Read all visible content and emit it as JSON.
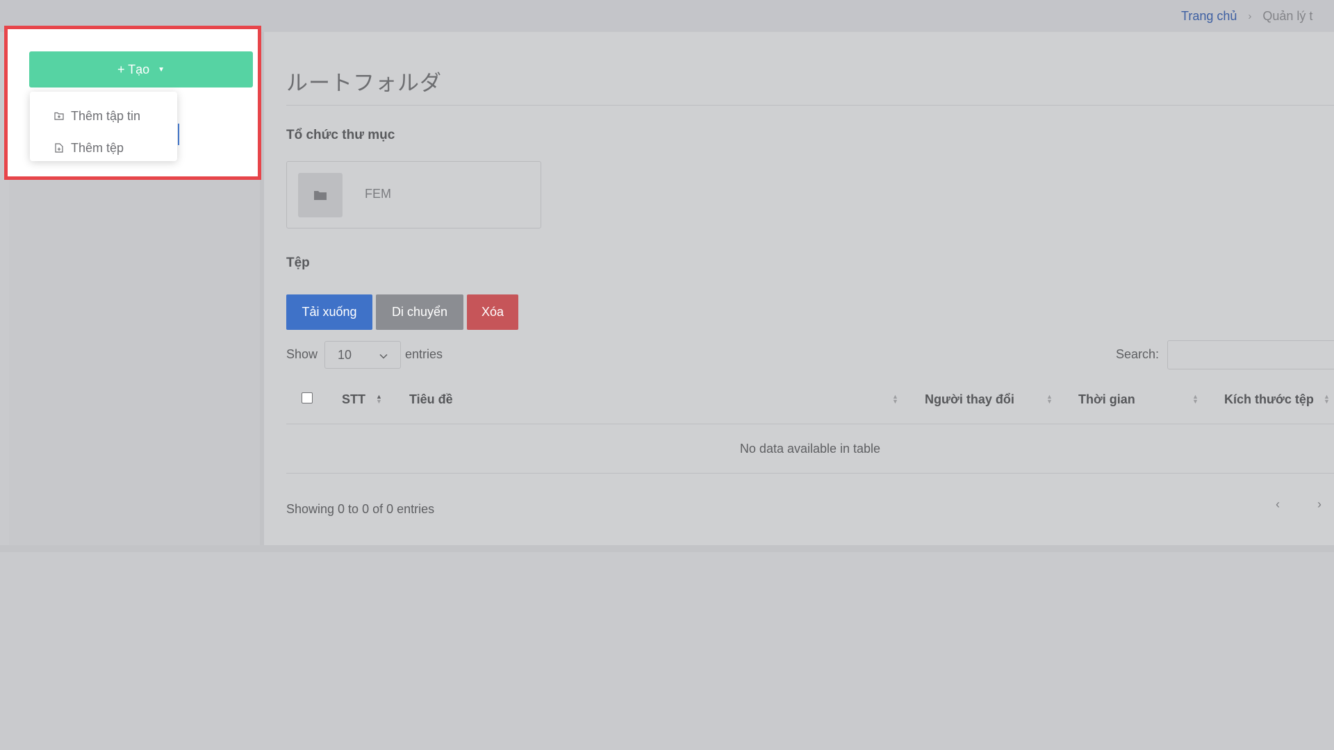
{
  "breadcrumb": {
    "home": "Trang chủ",
    "separator": "›",
    "current": "Quản lý t"
  },
  "create_menu": {
    "button_label": "+ Tạo",
    "items": [
      {
        "label": "Thêm tập tin",
        "icon": "folder-plus-icon"
      },
      {
        "label": "Thêm tệp",
        "icon": "file-plus-icon"
      }
    ]
  },
  "main": {
    "page_title": "ルートフォルダ",
    "folders_heading": "Tổ chức thư mục",
    "folders": [
      {
        "name": "FEM",
        "icon": "folder-icon"
      }
    ],
    "files_heading": "Tệp",
    "actions": {
      "download": "Tải xuống",
      "move": "Di chuyển",
      "delete": "Xóa"
    },
    "table_controls": {
      "show": "Show",
      "page_size": "10",
      "entries": "entries",
      "search_label": "Search:",
      "search_value": ""
    },
    "columns": [
      "STT",
      "Tiêu đề",
      "Người thay đổi",
      "Thời gian",
      "Kích thước tệp"
    ],
    "empty_message": "No data available in table",
    "info": "Showing 0 to 0 of 0 entries",
    "pagination": {
      "prev": "‹",
      "next": "›"
    }
  },
  "colors": {
    "create_button": "#56d3a3",
    "download": "#3f72c8",
    "move": "#8b8d92",
    "delete": "#c65559",
    "highlight_border": "#e7454a",
    "breadcrumb_link": "#3d5fa2"
  }
}
